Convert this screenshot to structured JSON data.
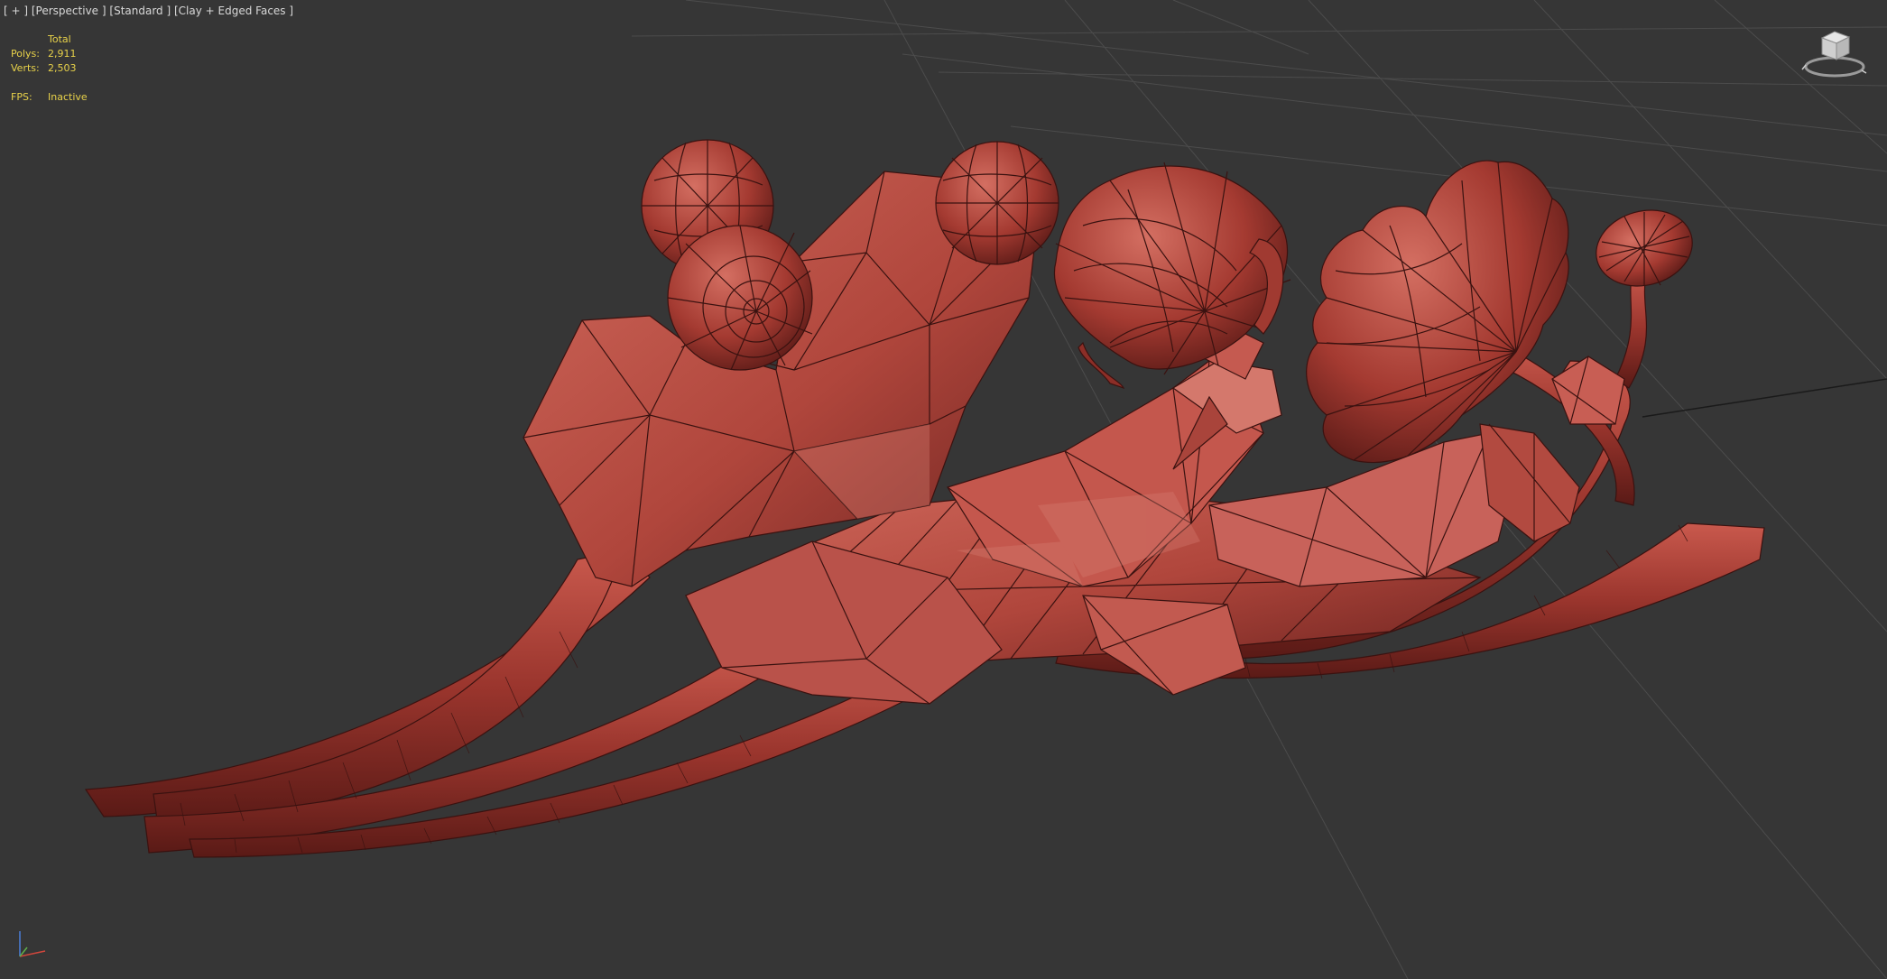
{
  "viewport": {
    "labels": [
      "[ + ]",
      "[Perspective ]",
      "[Standard ]",
      "[Clay + Edged Faces ]"
    ]
  },
  "stats": {
    "header": "Total",
    "polys_label": "Polys:",
    "polys_value": "2,911",
    "verts_label": "Verts:",
    "verts_value": "2,503",
    "fps_label": "FPS:",
    "fps_value": "Inactive"
  },
  "colors": {
    "background": "#363636",
    "grid": "#4a4a4a",
    "clay": "#b5473d",
    "clay_light": "#cf6a5e",
    "clay_dark": "#6e2420",
    "edge": "#3a1210",
    "stats_text": "#e8d24a",
    "label_text": "#d8d8d8"
  },
  "icons": {
    "viewcube": "viewcube-icon",
    "axis": "axis-tripod-icon"
  }
}
